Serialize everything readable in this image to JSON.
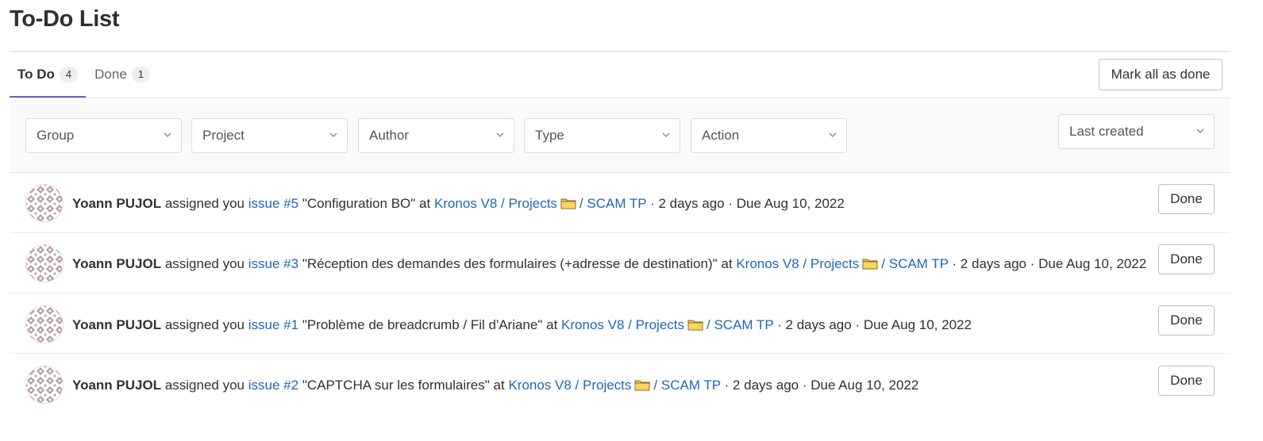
{
  "page": {
    "title": "To-Do List"
  },
  "tabs": [
    {
      "label": "To Do",
      "count": "4"
    },
    {
      "label": "Done",
      "count": "1"
    }
  ],
  "toolbar": {
    "mark_all_label": "Mark all as done"
  },
  "filters": {
    "group": "Group",
    "project": "Project",
    "author": "Author",
    "type": "Type",
    "action": "Action",
    "sort": "Last created"
  },
  "todos": [
    {
      "author": "Yoann PUJOL",
      "verb": "assigned you",
      "issue_link": "issue #5",
      "issue_title": "\"Configuration BO\"",
      "at": "at",
      "project_link": "Kronos V8 / Projects",
      "subproject_link": "/ SCAM TP",
      "meta": "· 2 days ago · Due Aug 10, 2022",
      "done_label": "Done"
    },
    {
      "author": "Yoann PUJOL",
      "verb": "assigned you",
      "issue_link": "issue #3",
      "issue_title": "\"Réception des demandes des formulaires (+adresse de destination)\"",
      "at": "at",
      "project_link": "Kronos V8 / Projects",
      "subproject_link": "/ SCAM TP",
      "meta": "· 2 days ago · Due Aug 10, 2022",
      "done_label": "Done"
    },
    {
      "author": "Yoann PUJOL",
      "verb": "assigned you",
      "issue_link": "issue #1",
      "issue_title": "\"Problème de breadcrumb / Fil d'Ariane\"",
      "at": "at",
      "project_link": "Kronos V8 / Projects",
      "subproject_link": "/ SCAM TP",
      "meta": "· 2 days ago · Due Aug 10, 2022",
      "done_label": "Done"
    },
    {
      "author": "Yoann PUJOL",
      "verb": "assigned you",
      "issue_link": "issue #2",
      "issue_title": "\"CAPTCHA sur les formulaires\"",
      "at": "at",
      "project_link": "Kronos V8 / Projects",
      "subproject_link": "/ SCAM TP",
      "meta": "· 2 days ago · Due Aug 10, 2022",
      "done_label": "Done"
    }
  ],
  "colors": {
    "link": "#1f67b8",
    "tab_underline": "#6666c4",
    "avatar_pattern": "#b39aa6"
  },
  "icons": {
    "folder": "folder-icon",
    "chevron": "chevron-down-icon"
  }
}
